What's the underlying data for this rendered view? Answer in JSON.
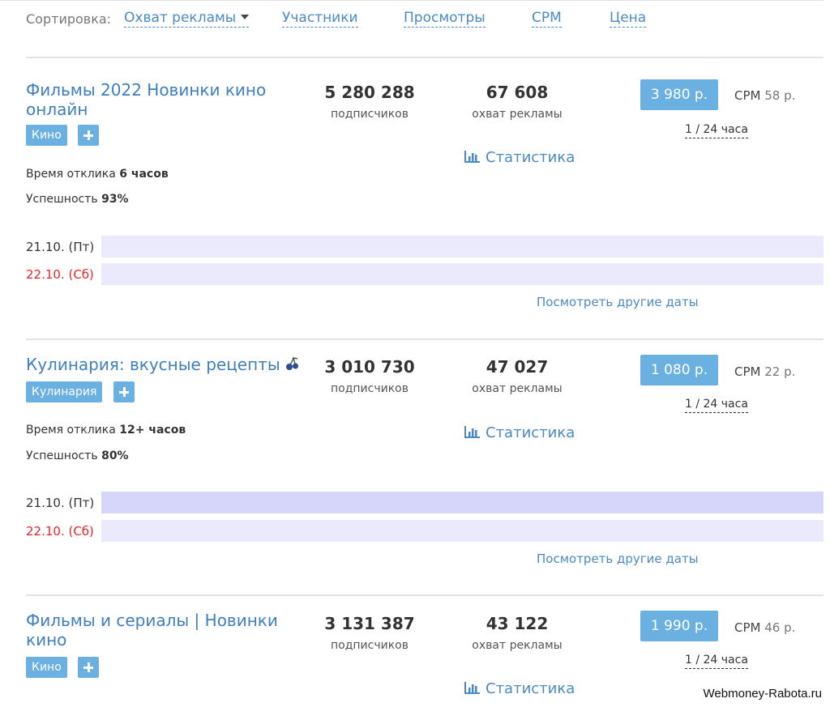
{
  "sort": {
    "label": "Сортировка:",
    "options": [
      "Охват рекламы",
      "Участники",
      "Просмотры",
      "CPM",
      "Цена"
    ]
  },
  "channels": [
    {
      "title": "Фильмы 2022 Новинки кино онлайн",
      "tag": "Кино",
      "response_label": "Время отклика ",
      "response_value": "6 часов",
      "success_label": "Успешность ",
      "success_value": "93%",
      "subscribers": "5 280 288",
      "subscribers_label": "подписчиков",
      "reach": "67 608",
      "reach_label": "охват рекламы",
      "stats_label": "Статистика",
      "price": "3 980 р.",
      "cpm_label": "CPM ",
      "cpm_value": "58 р.",
      "period": "1 / 24 часа",
      "dates": [
        {
          "label": "21.10. (Пт)",
          "weekend": false,
          "busy": false
        },
        {
          "label": "22.10. (Сб)",
          "weekend": true,
          "busy": false
        }
      ],
      "other_dates": "Посмотреть другие даты"
    },
    {
      "title": "Кулинария: вкусные рецепты",
      "title_icon": "cherries-icon",
      "tag": "Кулинария",
      "response_label": "Время отклика ",
      "response_value": "12+ часов",
      "success_label": "Успешность ",
      "success_value": "80%",
      "subscribers": "3 010 730",
      "subscribers_label": "подписчиков",
      "reach": "47 027",
      "reach_label": "охват рекламы",
      "stats_label": "Статистика",
      "price": "1 080 р.",
      "cpm_label": "CPM ",
      "cpm_value": "22 р.",
      "period": "1 / 24 часа",
      "dates": [
        {
          "label": "21.10. (Пт)",
          "weekend": false,
          "busy": true
        },
        {
          "label": "22.10. (Сб)",
          "weekend": true,
          "busy": false
        }
      ],
      "other_dates": "Посмотреть другие даты"
    },
    {
      "title": "Фильмы и сериалы | Новинки кино",
      "tag": "Кино",
      "subscribers": "3 131 387",
      "subscribers_label": "подписчиков",
      "reach": "43 122",
      "reach_label": "охват рекламы",
      "stats_label": "Статистика",
      "price": "1 990 р.",
      "cpm_label": "CPM ",
      "cpm_value": "46 р.",
      "period": "1 / 24 часа"
    }
  ],
  "colors": {
    "link": "#4a8ac6",
    "tag": "#6ab0e0",
    "weekend": "#e8232a",
    "date_bar": "#eaeafc",
    "date_bar_busy": "#d6d6fb"
  },
  "watermark": "Webmoney-Rabota.ru"
}
